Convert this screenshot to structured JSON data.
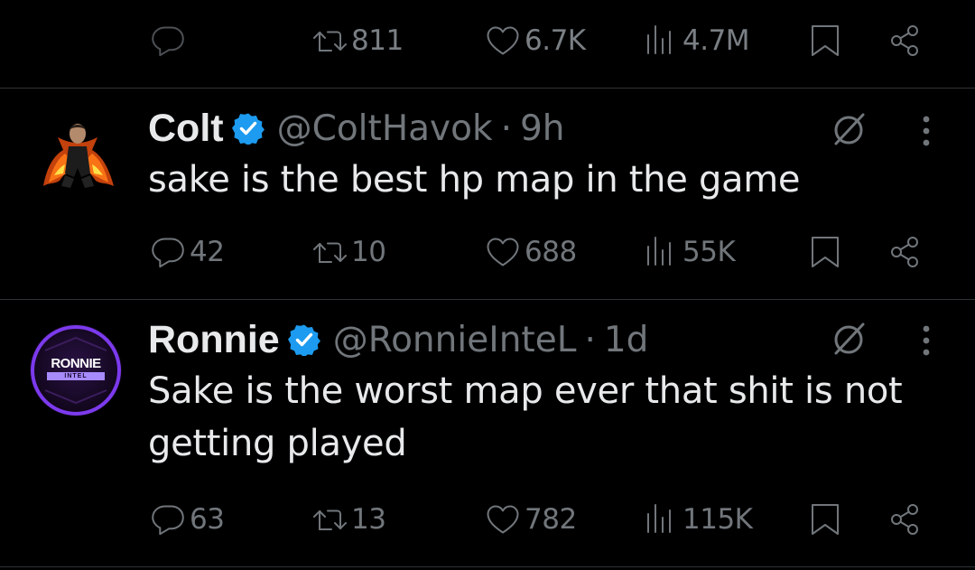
{
  "previous_tweet": {
    "actions": {
      "reply_count": "",
      "retweet_count": "811",
      "like_count": "6.7K",
      "view_count": "4.7M"
    }
  },
  "tweets": [
    {
      "display_name": "Colt",
      "handle": "@ColtHavok",
      "separator": "·",
      "time": "9h",
      "verified": true,
      "text": "sake is the best hp map in the game",
      "actions": {
        "reply_count": "42",
        "retweet_count": "10",
        "like_count": "688",
        "view_count": "55K"
      }
    },
    {
      "display_name": "Ronnie",
      "handle": "@RonnieInteL",
      "separator": "·",
      "time": "1d",
      "verified": true,
      "text": "Sake is the worst map ever that shit is not getting played",
      "avatar_logo_text": "RONNIE",
      "avatar_logo_subtext": "INTEL",
      "actions": {
        "reply_count": "63",
        "retweet_count": "13",
        "like_count": "782",
        "view_count": "115K"
      }
    }
  ],
  "icons": {
    "reply": "reply-bubble-icon",
    "retweet": "retweet-arrows-icon",
    "like": "heart-icon",
    "views": "analytics-bars-icon",
    "bookmark": "bookmark-icon",
    "share": "share-nodes-icon",
    "grok": "grok-slash-icon",
    "more": "vertical-dots-icon",
    "verified": "verified-badge-icon"
  },
  "colors": {
    "background": "#000000",
    "text_primary": "#e7e9ea",
    "text_secondary": "#71767b",
    "verified_blue": "#1d9bf0",
    "divider": "#2f3336",
    "ronnie_avatar_purple": "#6b2bb8"
  }
}
